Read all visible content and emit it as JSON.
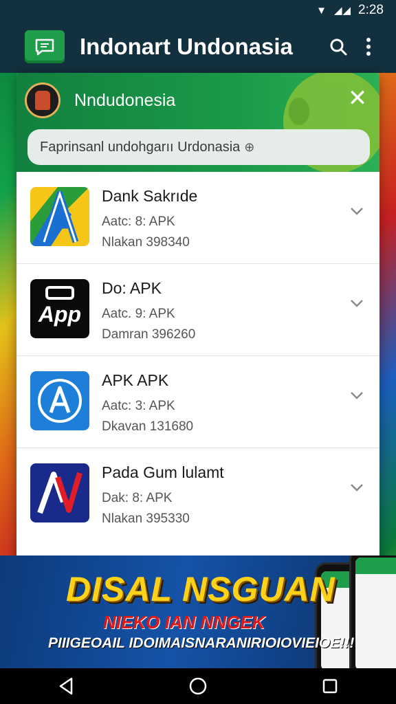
{
  "status_bar": {
    "time": "2:28"
  },
  "app_bar": {
    "title": "Indonart Undonasia",
    "icons": [
      "chat-logo-icon",
      "search-icon",
      "more-vert-icon"
    ]
  },
  "panel_header": {
    "title": "Nndudonesia",
    "search_value": "Faprinsanl undohgarıı Urdonasia"
  },
  "apps": [
    {
      "name": "Dank Sakrıde",
      "line1": "Aatc: 8: APK",
      "line2": "Nlakan 398340",
      "icon": "a-arrow-icon"
    },
    {
      "name": "Do: APK",
      "line1": "Aatc. 9: APK",
      "line2": "Damran 396260",
      "icon": "app-badge-icon"
    },
    {
      "name": "APK APK",
      "line1": "Aatc: 3: APK",
      "line2": "Dkavan 131680",
      "icon": "a-circle-icon"
    },
    {
      "name": "Pada Gum lulamt",
      "line1": "Dak: 8: APK",
      "line2": "Nlakan 395330",
      "icon": "av-logo-icon"
    }
  ],
  "banner": {
    "title": "DISAL NSGUAN",
    "subtitle": "NIEKO IAN NNGEK",
    "tagline": "PIIIGEOAIL IDOIMAISNARANIRIOIOVIEIOE!!!"
  },
  "colors": {
    "accent_green": "#1a9a48",
    "app_bar": "#12303d",
    "banner_yellow": "#ffd21a"
  }
}
